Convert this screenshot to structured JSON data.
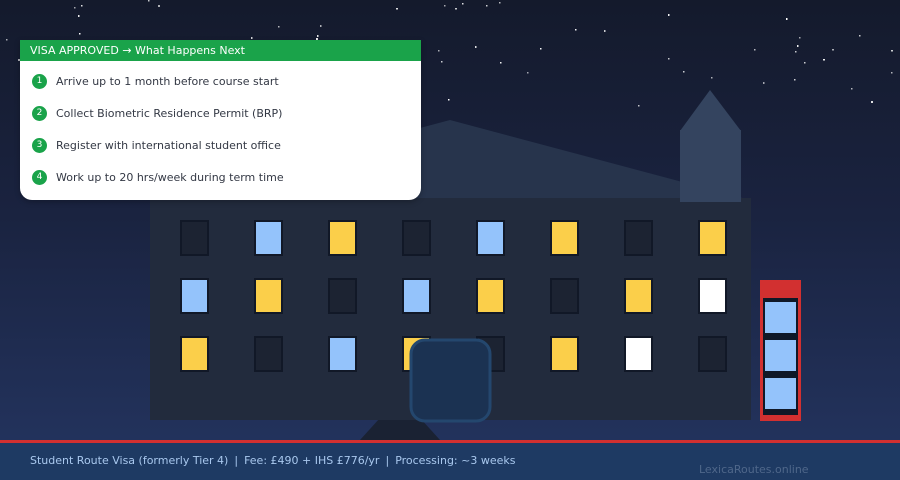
{
  "panel": {
    "title": "VISA APPROVED → What Happens Next",
    "steps": [
      {
        "num": "1",
        "text": "Arrive up to 1 month before course start"
      },
      {
        "num": "2",
        "text": "Collect Biometric Residence Permit (BRP)"
      },
      {
        "num": "3",
        "text": "Register with international student office"
      },
      {
        "num": "4",
        "text": "Work up to 20 hrs/week during term time"
      }
    ]
  },
  "footer": {
    "route": "Student Route Visa (formerly Tier 4)",
    "separator": "|",
    "fee": "Fee: £490 + IHS £776/yr",
    "processing": "Processing: ~3 weeks",
    "watermark": "LexicaRoutes.online"
  },
  "colors": {
    "sky_top": "#141a2c",
    "sky_bottom": "#243561",
    "building": "#222b3d",
    "roof": "#27344c",
    "tower": "#34445f",
    "window_dark": "#1c2332",
    "window_yellow": "#fbcf4a",
    "window_blue": "#94c3fb",
    "window_white": "#ffffff",
    "phone_box": "#d23030",
    "accent_green": "#1aa34a",
    "footer_bg": "#1e3a63",
    "footer_border": "#d23030"
  },
  "windows": [
    [
      "dark",
      "blue",
      "yellow",
      "dark",
      "blue",
      "yellow",
      "dark",
      "yellow"
    ],
    [
      "blue",
      "yellow",
      "dark",
      "blue",
      "yellow",
      "dark",
      "yellow",
      "white"
    ],
    [
      "yellow",
      "dark",
      "blue",
      "yellow",
      "dark",
      "yellow",
      "white",
      "dark"
    ]
  ]
}
